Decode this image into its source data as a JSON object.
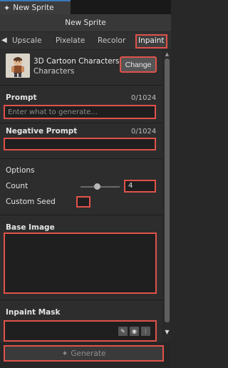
{
  "window": {
    "tab_title": "New Sprite",
    "icon": "sparkle-icon"
  },
  "header": {
    "title": "New Sprite"
  },
  "tabs": [
    {
      "label": "Upscale"
    },
    {
      "label": "Pixelate"
    },
    {
      "label": "Recolor"
    },
    {
      "label": "Inpaint",
      "active": true
    }
  ],
  "model": {
    "name": "3D Cartoon Characters",
    "category": "Characters",
    "change_label": "Change"
  },
  "prompt": {
    "label": "Prompt",
    "counter": "0/1024",
    "placeholder": "Enter what to generate..."
  },
  "negative_prompt": {
    "label": "Negative Prompt",
    "counter": "0/1024",
    "value": ""
  },
  "options": {
    "label": "Options",
    "count_label": "Count",
    "count_value": "4",
    "custom_seed_label": "Custom Seed"
  },
  "base_image": {
    "label": "Base Image"
  },
  "inpaint_mask": {
    "label": "Inpaint Mask",
    "icons": [
      "pencil-icon",
      "target-icon",
      "more-icon"
    ]
  },
  "generate": {
    "label": "Generate",
    "icon": "sparkle-icon"
  },
  "colors": {
    "highlight": "#e0524a",
    "active_tab_top": "#3a79bb"
  }
}
